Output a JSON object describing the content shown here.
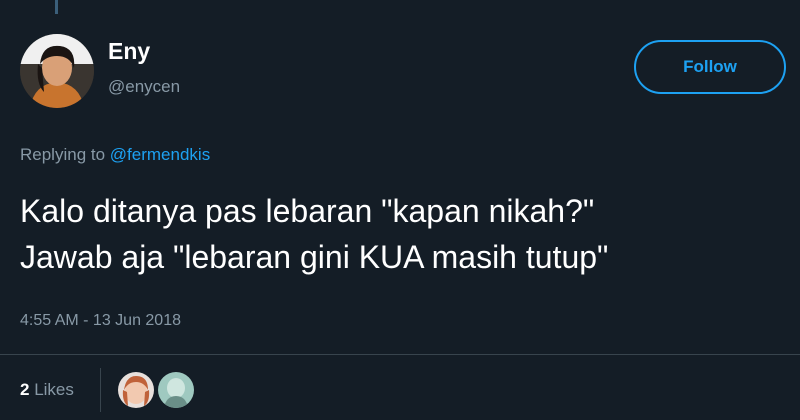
{
  "tweet": {
    "author": {
      "name": "Eny",
      "handle": "@enycen"
    },
    "follow_label": "Follow",
    "reply": {
      "prefix": "Replying to",
      "mention": "@fermendkis"
    },
    "text_lines": [
      "Kalo ditanya pas lebaran \"kapan nikah?\"",
      "Jawab aja \"lebaran gini KUA masih tutup\""
    ],
    "timestamp": "4:55 AM - 13 Jun 2018",
    "likes": {
      "count": "2",
      "label": "Likes"
    }
  },
  "colors": {
    "background": "#141d26",
    "accent": "#1da1f2",
    "secondary_text": "#8899a6",
    "divider": "#38444d"
  },
  "icons": [
    "avatar",
    "liker-avatar-1",
    "liker-avatar-2"
  ]
}
